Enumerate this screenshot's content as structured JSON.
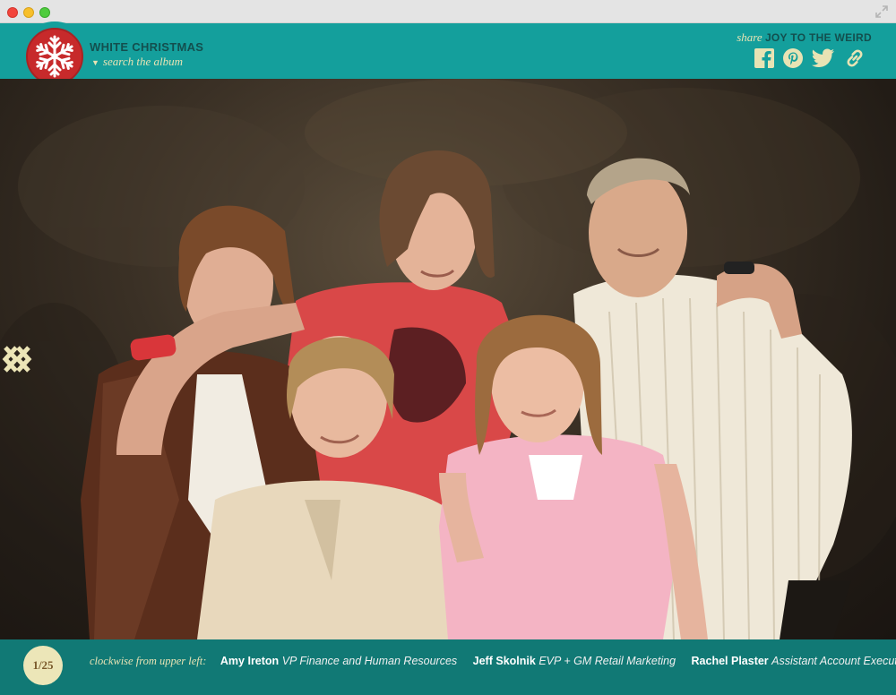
{
  "colors": {
    "header_bg": "#149f9c",
    "footer_bg": "#117975",
    "logo_red": "#c72a2b",
    "cream": "#e8e3b4",
    "title_dark": "#134f4e"
  },
  "header": {
    "album_title": "WHITE CHRISTMAS",
    "search_label": "search the album",
    "logo_icon": "snowflake-icon",
    "share_word": "share",
    "share_name": "JOY TO THE WEIRD",
    "social_icons": [
      "facebook-icon",
      "pinterest-icon",
      "twitter-icon",
      "link-icon"
    ]
  },
  "slideshow": {
    "prev_icon": "double-chevron-left-icon",
    "next_icon": "double-chevron-right-icon",
    "counter": "1/25"
  },
  "caption": {
    "lead": "clockwise from upper left:",
    "people": [
      {
        "name": "Amy Ireton",
        "role": "VP Finance and Human Resources"
      },
      {
        "name": "Jeff Skolnik",
        "role": "EVP + GM Retail Marketing"
      },
      {
        "name": "Rachel Plaster",
        "role": "Assistant Account Executive"
      }
    ]
  }
}
